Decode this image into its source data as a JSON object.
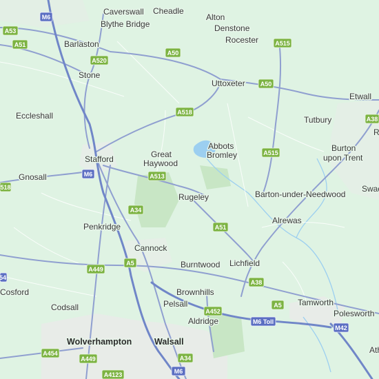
{
  "map": {
    "places": [
      {
        "name": "Caverswall",
        "major": false
      },
      {
        "name": "Cheadle",
        "major": false
      },
      {
        "name": "Alton",
        "major": false
      },
      {
        "name": "Blythe Bridge",
        "major": false
      },
      {
        "name": "Denstone",
        "major": false
      },
      {
        "name": "Barlaston",
        "major": false
      },
      {
        "name": "Rocester",
        "major": false
      },
      {
        "name": "Stone",
        "major": false
      },
      {
        "name": "Uttoxeter",
        "major": false
      },
      {
        "name": "Etwall",
        "major": false
      },
      {
        "name": "Eccleshall",
        "major": false
      },
      {
        "name": "Tutbury",
        "major": false
      },
      {
        "name": "Abbots",
        "major": false
      },
      {
        "name": "Bromley",
        "major": false
      },
      {
        "name": "Great",
        "major": false
      },
      {
        "name": "Haywood",
        "major": false
      },
      {
        "name": "Burton",
        "major": false
      },
      {
        "name": "upon Trent",
        "major": false
      },
      {
        "name": "Stafford",
        "major": false
      },
      {
        "name": "Gnosall",
        "major": false
      },
      {
        "name": "Rugeley",
        "major": false
      },
      {
        "name": "Barton-under-Needwood",
        "major": false
      },
      {
        "name": "Swad",
        "major": false
      },
      {
        "name": "Alrewas",
        "major": false
      },
      {
        "name": "Penkridge",
        "major": false
      },
      {
        "name": "Cannock",
        "major": false
      },
      {
        "name": "Burntwood",
        "major": false
      },
      {
        "name": "Lichfield",
        "major": false
      },
      {
        "name": "Brownhills",
        "major": false
      },
      {
        "name": "Cosford",
        "major": false
      },
      {
        "name": "Pelsall",
        "major": false
      },
      {
        "name": "Tamworth",
        "major": false
      },
      {
        "name": "Codsall",
        "major": false
      },
      {
        "name": "Polesworth",
        "major": false
      },
      {
        "name": "Aldridge",
        "major": false
      },
      {
        "name": "Wolverhampton",
        "major": true
      },
      {
        "name": "Walsall",
        "major": true
      },
      {
        "name": "Ath",
        "major": false
      },
      {
        "name": "R",
        "major": false
      }
    ],
    "road_labels": [
      {
        "ref": "M6",
        "type": "motorway"
      },
      {
        "ref": "A53",
        "type": "a-road"
      },
      {
        "ref": "A51",
        "type": "a-road"
      },
      {
        "ref": "A520",
        "type": "a-road"
      },
      {
        "ref": "A50",
        "type": "a-road"
      },
      {
        "ref": "A515",
        "type": "a-road"
      },
      {
        "ref": "A50",
        "type": "a-road"
      },
      {
        "ref": "A518",
        "type": "a-road"
      },
      {
        "ref": "A38",
        "type": "a-road"
      },
      {
        "ref": "A515",
        "type": "a-road"
      },
      {
        "ref": "M6",
        "type": "motorway"
      },
      {
        "ref": "A513",
        "type": "a-road"
      },
      {
        "ref": "518",
        "type": "a-road"
      },
      {
        "ref": "A34",
        "type": "a-road"
      },
      {
        "ref": "A51",
        "type": "a-road"
      },
      {
        "ref": "A449",
        "type": "a-road"
      },
      {
        "ref": "A5",
        "type": "a-road"
      },
      {
        "ref": "54",
        "type": "a-road"
      },
      {
        "ref": "A38",
        "type": "a-road"
      },
      {
        "ref": "A5",
        "type": "a-road"
      },
      {
        "ref": "A452",
        "type": "a-road"
      },
      {
        "ref": "M6 Toll",
        "type": "motorway"
      },
      {
        "ref": "M42",
        "type": "motorway"
      },
      {
        "ref": "A454",
        "type": "a-road"
      },
      {
        "ref": "A449",
        "type": "a-road"
      },
      {
        "ref": "A34",
        "type": "a-road"
      },
      {
        "ref": "A4123",
        "type": "a-road"
      },
      {
        "ref": "M6",
        "type": "motorway"
      }
    ],
    "colors": {
      "land": "#dff3e3",
      "a_road_shield": "#7cb342",
      "motorway_shield": "#5b6ec2",
      "water": "#9ccff0"
    }
  }
}
